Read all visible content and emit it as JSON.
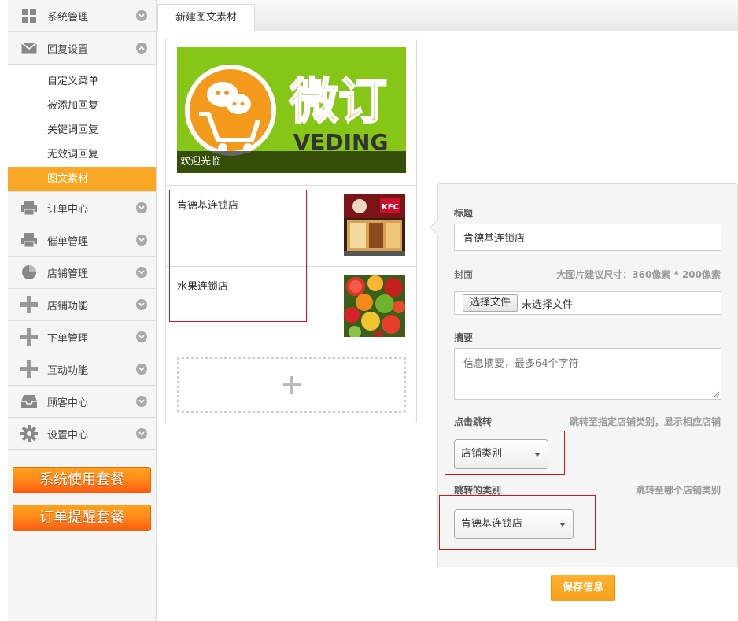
{
  "sidebar": {
    "items": [
      {
        "label": "系统管理",
        "icon": "grid-icon"
      },
      {
        "label": "回复设置",
        "icon": "envelope-icon",
        "expanded": true
      },
      {
        "label": "订单中心",
        "icon": "printer-icon"
      },
      {
        "label": "催单管理",
        "icon": "printer-icon"
      },
      {
        "label": "店铺管理",
        "icon": "pie-chart-icon"
      },
      {
        "label": "店铺功能",
        "icon": "plus-icon"
      },
      {
        "label": "下单管理",
        "icon": "plus-icon"
      },
      {
        "label": "互动功能",
        "icon": "plus-icon"
      },
      {
        "label": "顾客中心",
        "icon": "inbox-icon"
      },
      {
        "label": "设置中心",
        "icon": "gear-icon"
      }
    ],
    "subitems": [
      "自定义菜单",
      "被添加回复",
      "关键词回复",
      "无效词回复",
      "图文素材"
    ],
    "active_subitem": "图文素材",
    "promos": [
      "系统使用套餐",
      "订单提醒套餐"
    ]
  },
  "tab": {
    "label": "新建图文素材"
  },
  "articles": {
    "cover": {
      "logo_text": "微订",
      "logo_sub": "VEDING",
      "caption": "欢迎光临"
    },
    "items": [
      {
        "title": "肯德基连锁店",
        "thumb": "kfc-storefront"
      },
      {
        "title": "水果连锁店",
        "thumb": "fruit-pile"
      }
    ]
  },
  "form": {
    "title_label": "标题",
    "title_value": "肯德基连锁店",
    "cover_label": "封面",
    "cover_hint": "大图片建议尺寸：360像素 * 200像素",
    "file_button": "选择文件",
    "file_status": "未选择文件",
    "summary_label": "摘要",
    "summary_placeholder": "信息摘要，最多64个字符",
    "jump_label": "点击跳转",
    "jump_hint": "跳转至指定店铺类别，显示相应店铺",
    "jump_value": "店铺类别",
    "category_label": "跳转的类别",
    "category_hint": "跳转至哪个店铺类别",
    "category_value": "肯德基连锁店",
    "save_label": "保存信息"
  },
  "colors": {
    "accent": "#f9a825",
    "highlight_border": "#c9161c",
    "cover_bg": "#85c616"
  }
}
